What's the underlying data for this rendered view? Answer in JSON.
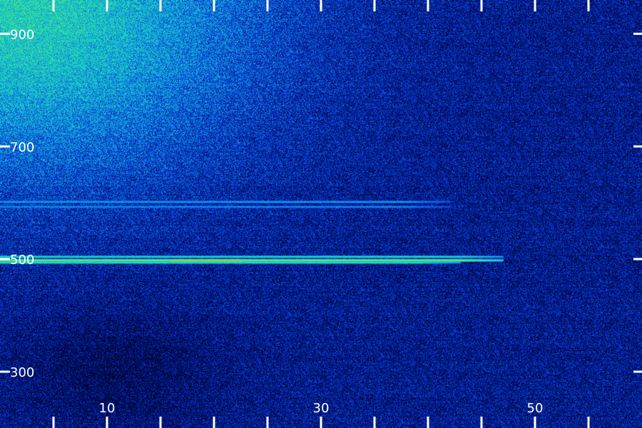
{
  "chart_data": {
    "type": "heatmap",
    "title": "",
    "xlabel": "",
    "ylabel": "",
    "xlim": [
      0,
      60
    ],
    "ylim": [
      200,
      960
    ],
    "x_ticks": [
      10,
      30,
      50
    ],
    "x_minor_ticks": [
      5,
      15,
      20,
      25,
      35,
      40,
      45,
      55
    ],
    "y_ticks": [
      300,
      500,
      700,
      900
    ],
    "colormap": [
      "#000010",
      "#00107a",
      "#0a3ed8",
      "#10a8e0",
      "#22e0b0",
      "#70f040",
      "#e8a020"
    ],
    "background_gradient": {
      "peak_x": 2,
      "peak_y": 940,
      "peak_intensity": 0.62,
      "base_intensity": 0.2,
      "note": ""
    },
    "lines": [
      {
        "y": 602,
        "x_start": 0,
        "x_end": 42,
        "intensity": 0.48
      },
      {
        "y": 593,
        "x_start": 0,
        "x_end": 42,
        "intensity": 0.45
      },
      {
        "y": 505,
        "x_start": 0,
        "x_end": 47,
        "intensity": 0.62
      },
      {
        "y": 498,
        "x_start": 0,
        "x_end": 47,
        "intensity": 0.8
      },
      {
        "y": 494,
        "x_start": 0,
        "x_end": 43,
        "intensity": 0.65
      }
    ]
  }
}
